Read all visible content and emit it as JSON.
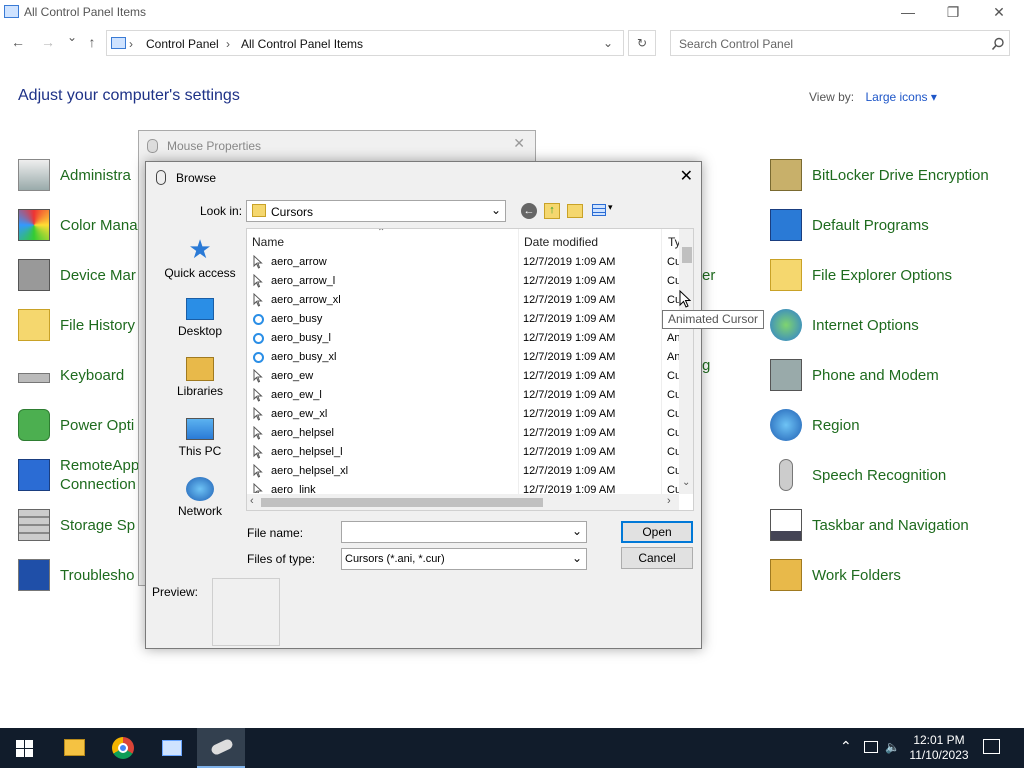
{
  "window": {
    "title": "All Control Panel Items",
    "minimize": "—",
    "maximize": "❐",
    "close": "✕"
  },
  "nav": {
    "back": "←",
    "forward": "→",
    "recent": "⌄",
    "up": "↑",
    "breadcrumbs": [
      "Control Panel",
      "All Control Panel Items"
    ],
    "refresh": "↻",
    "search_placeholder": "Search Control Panel"
  },
  "header": {
    "title": "Adjust your computer's settings",
    "view_by_label": "View by:",
    "view_by_value": "Large icons"
  },
  "left_items": [
    "Administra",
    "Color Mana",
    "Device Mar",
    "File History",
    "Keyboard",
    "Power Opti",
    "RemoteApp\nConnection",
    "Storage Sp",
    "Troublesho"
  ],
  "right_items": [
    "BitLocker Drive Encryption",
    "Default Programs",
    "File Explorer Options",
    "Internet Options",
    "Phone and Modem",
    "Region",
    "Speech Recognition",
    "Taskbar and Navigation",
    "Work Folders"
  ],
  "middle_partial": [
    "er",
    "g"
  ],
  "mouse_dialog": {
    "title": "Mouse Properties",
    "close": "✕"
  },
  "browse": {
    "title": "Browse",
    "close": "✕",
    "look_in_label": "Look in:",
    "look_in_value": "Cursors",
    "places": [
      "Quick access",
      "Desktop",
      "Libraries",
      "This PC",
      "Network"
    ],
    "columns": [
      "Name",
      "Date modified",
      "Ty"
    ],
    "files": [
      {
        "name": "aero_arrow",
        "date": "12/7/2019 1:09 AM",
        "type": "Cu"
      },
      {
        "name": "aero_arrow_l",
        "date": "12/7/2019 1:09 AM",
        "type": "Cu"
      },
      {
        "name": "aero_arrow_xl",
        "date": "12/7/2019 1:09 AM",
        "type": "Cu"
      },
      {
        "name": "aero_busy",
        "date": "12/7/2019 1:09 AM",
        "type": "An"
      },
      {
        "name": "aero_busy_l",
        "date": "12/7/2019 1:09 AM",
        "type": "An"
      },
      {
        "name": "aero_busy_xl",
        "date": "12/7/2019 1:09 AM",
        "type": "An"
      },
      {
        "name": "aero_ew",
        "date": "12/7/2019 1:09 AM",
        "type": "Cu"
      },
      {
        "name": "aero_ew_l",
        "date": "12/7/2019 1:09 AM",
        "type": "Cu"
      },
      {
        "name": "aero_ew_xl",
        "date": "12/7/2019 1:09 AM",
        "type": "Cu"
      },
      {
        "name": "aero_helpsel",
        "date": "12/7/2019 1:09 AM",
        "type": "Cu"
      },
      {
        "name": "aero_helpsel_l",
        "date": "12/7/2019 1:09 AM",
        "type": "Cu"
      },
      {
        "name": "aero_helpsel_xl",
        "date": "12/7/2019 1:09 AM",
        "type": "Cu"
      },
      {
        "name": "aero_link",
        "date": "12/7/2019 1:09 AM",
        "type": "Cu"
      }
    ],
    "file_name_label": "File name:",
    "file_name_value": "",
    "files_of_type_label": "Files of type:",
    "files_of_type_value": "Cursors (*.ani, *.cur)",
    "open_label": "Open",
    "cancel_label": "Cancel",
    "preview_label": "Preview:"
  },
  "tooltip": "Animated Cursor",
  "taskbar": {
    "time": "12:01 PM",
    "date": "11/10/2023"
  },
  "colors": {
    "accent": "#0078d7",
    "link_green": "#1e6b1e",
    "heading_blue": "#1e3287",
    "taskbar": "#111c2b"
  }
}
